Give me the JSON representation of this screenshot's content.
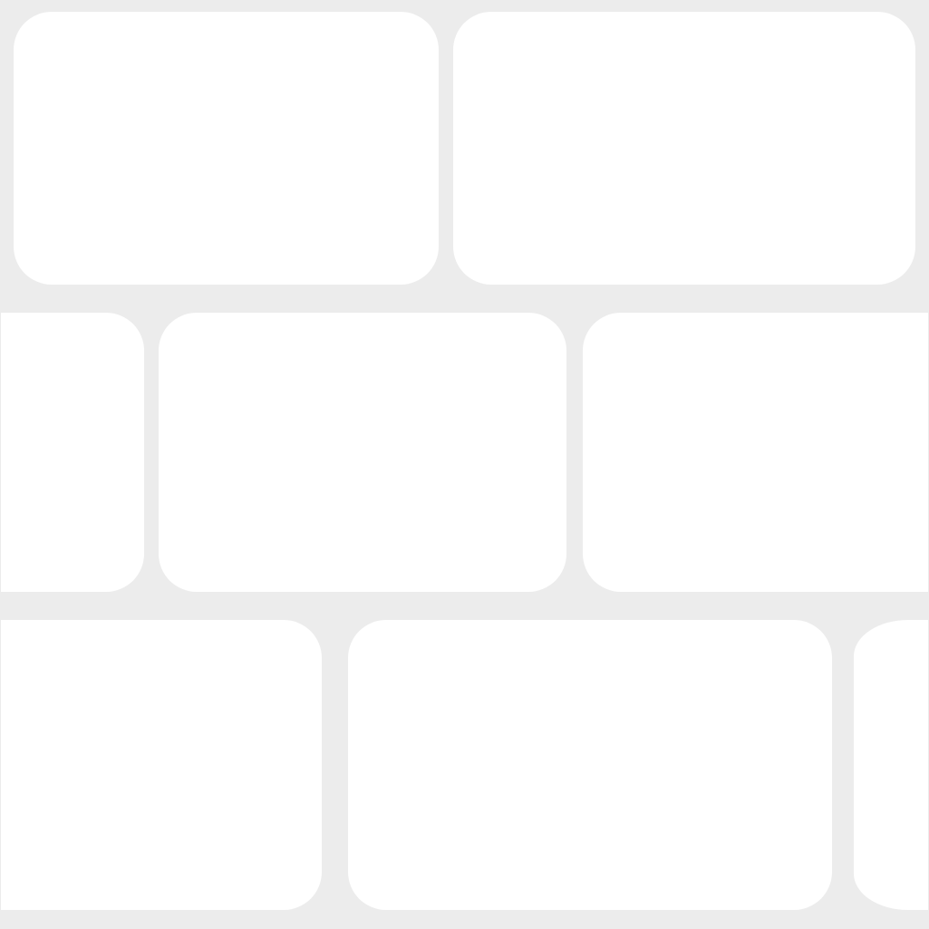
{
  "tiles": [
    {
      "row": 1,
      "position": 1
    },
    {
      "row": 1,
      "position": 2
    },
    {
      "row": 2,
      "position": 1
    },
    {
      "row": 2,
      "position": 2
    },
    {
      "row": 2,
      "position": 3
    },
    {
      "row": 3,
      "position": 1
    },
    {
      "row": 3,
      "position": 2
    },
    {
      "row": 3,
      "position": 3
    }
  ],
  "colors": {
    "background": "#ececec",
    "tile": "#ffffff"
  }
}
